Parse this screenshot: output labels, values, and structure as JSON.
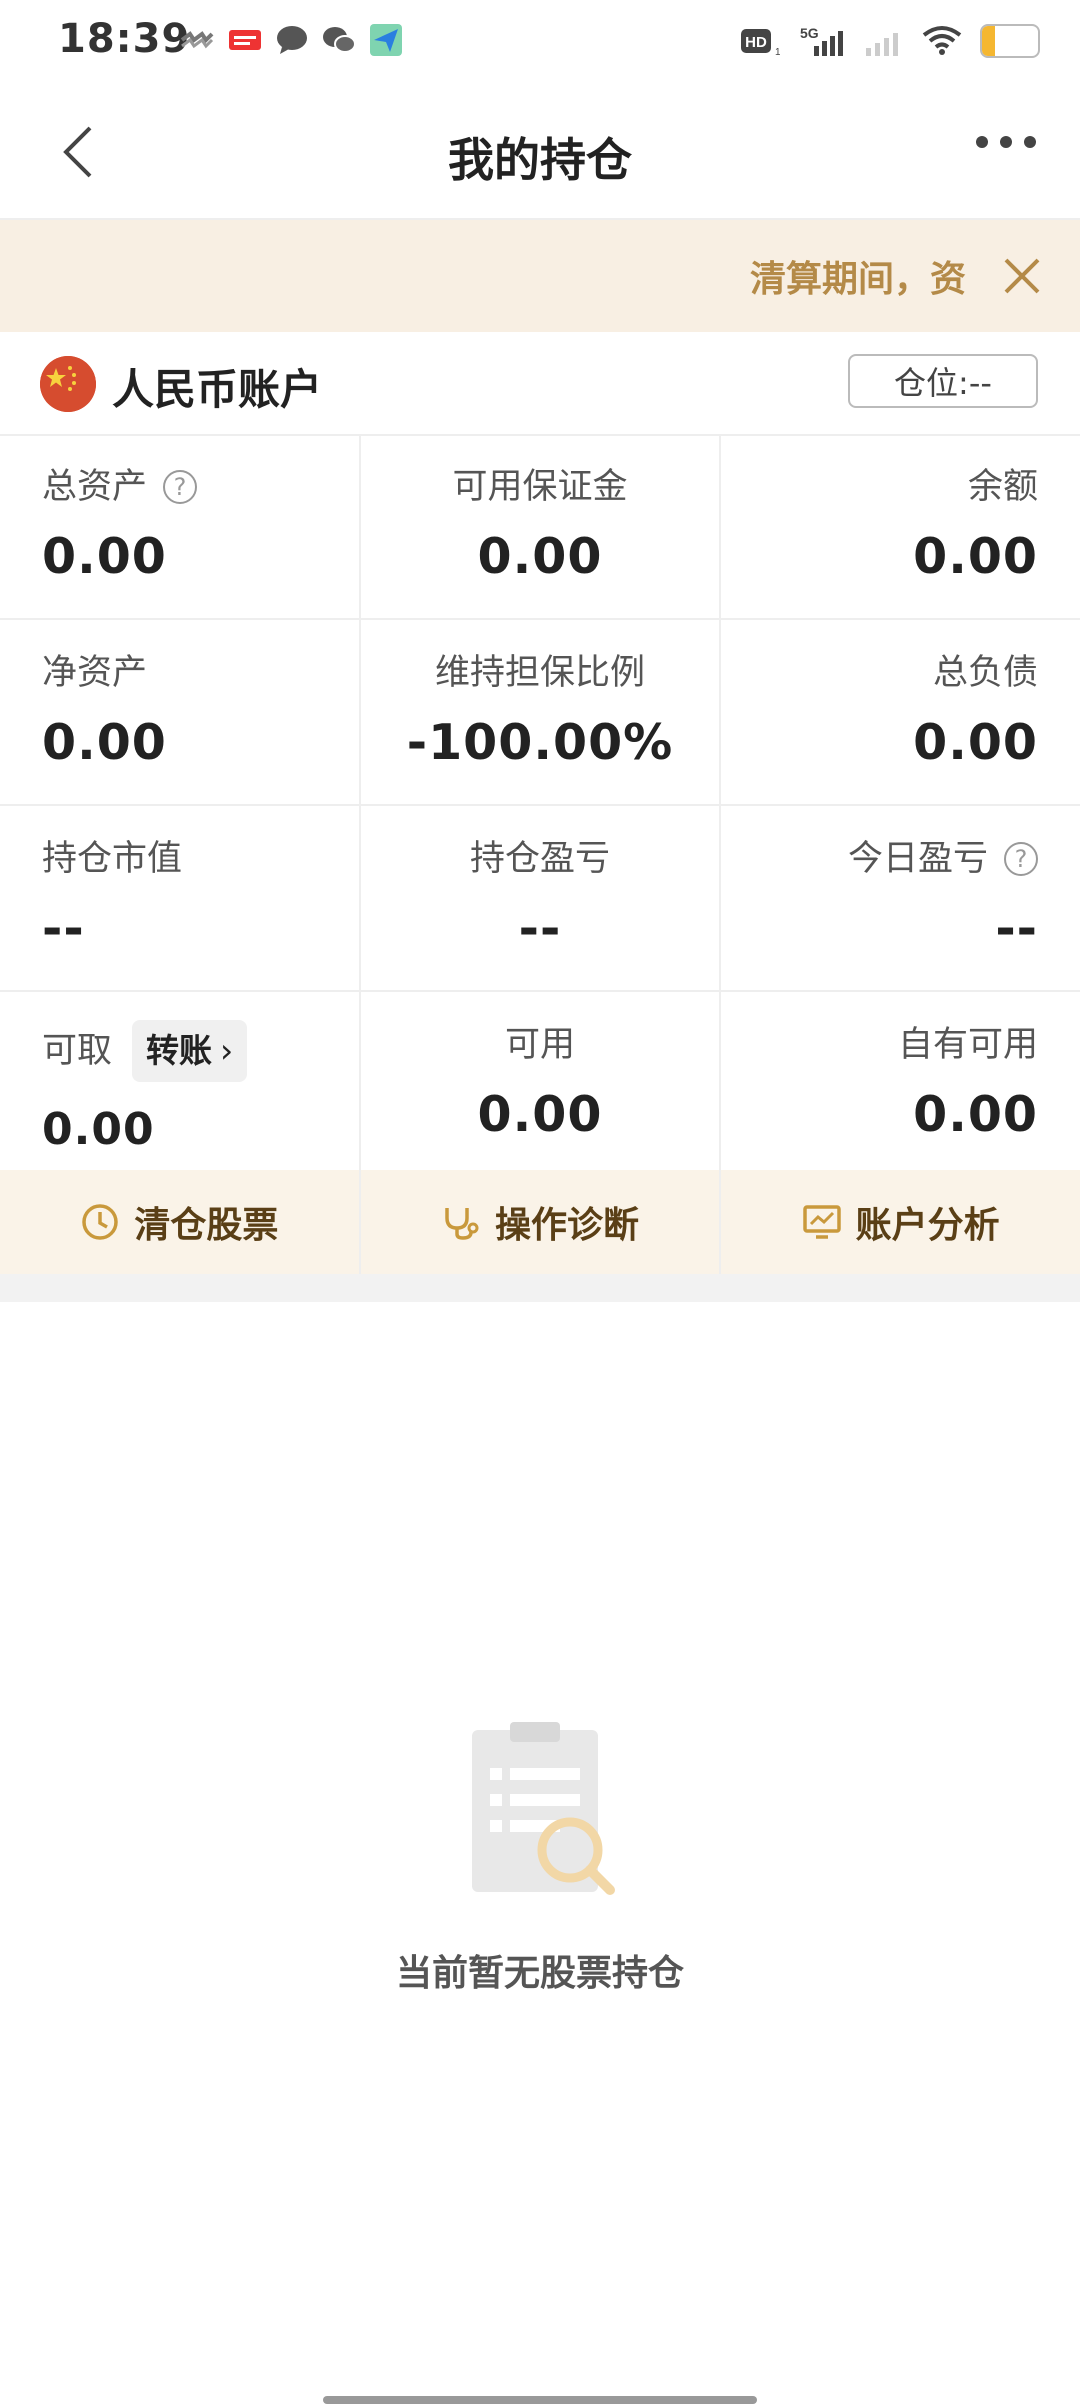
{
  "status_bar": {
    "time": "18:39",
    "left_icons": [
      "link-icon",
      "toutiao-icon",
      "message-bubble-icon",
      "wechat-icon",
      "send-icon"
    ],
    "right_icons": [
      "hd-icon",
      "signal-5g-icon",
      "signal-icon",
      "wifi-icon"
    ],
    "hd_label": "HD",
    "network_label": "5G",
    "battery": "23",
    "battery_level": 0.23
  },
  "nav": {
    "title": "我的持仓"
  },
  "notice": {
    "text": "清算期间，资"
  },
  "account": {
    "label": "人民币账户",
    "position_button": "仓位:--"
  },
  "grid": {
    "row1": [
      {
        "label": "总资产",
        "value": "0.00"
      },
      {
        "label": "可用保证金",
        "value": "0.00"
      },
      {
        "label": "余额",
        "value": "0.00"
      }
    ],
    "row2": [
      {
        "label": "净资产",
        "value": "0.00"
      },
      {
        "label": "维持担保比例",
        "value": "-100.00%"
      },
      {
        "label": "总负债",
        "value": "0.00"
      }
    ],
    "row3": [
      {
        "label": "持仓市值",
        "value": "--"
      },
      {
        "label": "持仓盈亏",
        "value": "--"
      },
      {
        "label": "今日盈亏",
        "value": "--"
      }
    ],
    "row4": [
      {
        "label": "可取",
        "value": "0.00",
        "button": "转账"
      },
      {
        "label": "可用",
        "value": "0.00"
      },
      {
        "label": "自有可用",
        "value": "0.00"
      }
    ]
  },
  "actions": [
    {
      "label": "清仓股票",
      "icon": "clock-icon"
    },
    {
      "label": "操作诊断",
      "icon": "stethoscope-icon"
    },
    {
      "label": "账户分析",
      "icon": "monitor-chart-icon"
    }
  ],
  "empty_state": {
    "text": "当前暂无股票持仓",
    "icon": "clipboard-search-icon"
  },
  "colors": {
    "accent": "#b48a48",
    "notice_bg": "#f8efe3",
    "action_bg": "#faf3e8",
    "action_text": "#5a3f16"
  }
}
